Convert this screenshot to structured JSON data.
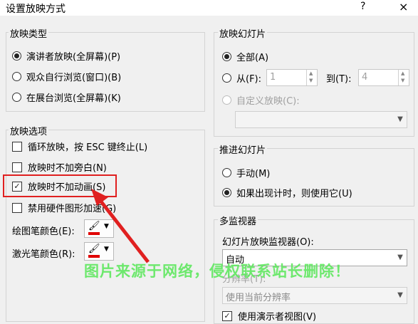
{
  "window": {
    "title": "设置放映方式",
    "help": "?",
    "close": "×"
  },
  "show_type": {
    "title": "放映类型",
    "options": [
      {
        "label": "演讲者放映(全屏幕)(P)",
        "checked": true
      },
      {
        "label": "观众自行浏览(窗口)(B)",
        "checked": false
      },
      {
        "label": "在展台浏览(全屏幕)(K)",
        "checked": false
      }
    ]
  },
  "show_options": {
    "title": "放映选项",
    "items": [
      {
        "label": "循环放映，按 ESC 键终止(L)",
        "checked": false
      },
      {
        "label": "放映时不加旁白(N)",
        "checked": false
      },
      {
        "label": "放映时不加动画(S)",
        "checked": true
      },
      {
        "label": "禁用硬件图形加速(G)",
        "checked": false
      }
    ],
    "pen_color_label": "绘图笔颜色(E):",
    "laser_color_label": "激光笔颜色(R):",
    "pen_color": "#e00000",
    "laser_color": "#e00000"
  },
  "slides": {
    "title": "放映幻灯片",
    "all_label": "全部(A)",
    "from_label": "从(F):",
    "from_value": "1",
    "to_label": "到(T):",
    "to_value": "4",
    "custom_label": "自定义放映(C):",
    "custom_value": ""
  },
  "advance": {
    "title": "推进幻灯片",
    "manual_label": "手动(M)",
    "timing_label": "如果出现计时，则使用它(U)"
  },
  "monitors": {
    "title": "多监视器",
    "monitor_label": "幻灯片放映监视器(O):",
    "monitor_value": "自动",
    "resolution_label": "分辨率(T):",
    "resolution_value": "使用当前分辨率",
    "presenter_view_label": "使用演示者视图(V)"
  },
  "overlay": {
    "watermark": "图片来源于网络，侵权联系站长删除！"
  }
}
